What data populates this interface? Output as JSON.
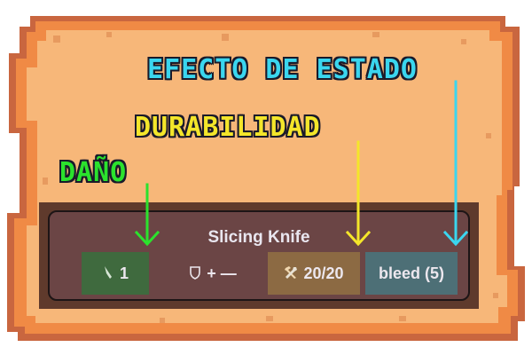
{
  "annotations": {
    "status_effect": "EFECTO DE ESTADO",
    "durability": "DURABILIDAD",
    "damage": "DAÑO"
  },
  "item": {
    "name": "Slicing Knife",
    "damage": "1",
    "defense": "+ —",
    "durability": "20/20",
    "status_effect": "bleed (5)"
  },
  "icons": {
    "damage": "knife-icon",
    "defense": "shield-icon",
    "durability": "hammer-wrench-icon"
  },
  "colors": {
    "damage_label": "#2be22d",
    "durability_label": "#f4e62a",
    "status_label": "#3ad6ef",
    "card_bg": "#6b4545",
    "parchment": "#f7b779"
  }
}
